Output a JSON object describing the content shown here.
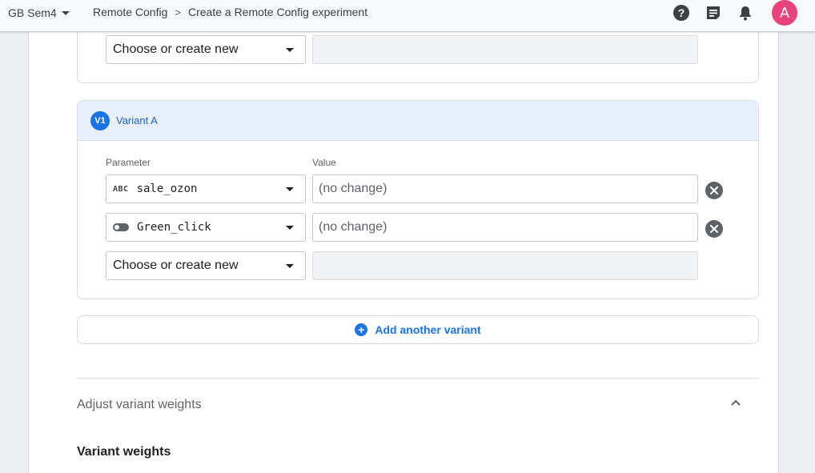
{
  "topbar": {
    "project": "GB Sem4",
    "breadcrumb": {
      "section": "Remote Config",
      "separator": ">",
      "current": "Create a Remote Config experiment"
    },
    "avatar_letter": "A",
    "icons": [
      "help-icon",
      "feedback-icon",
      "notifications-icon"
    ]
  },
  "top_card": {
    "select_placeholder": "Choose or create new"
  },
  "variant": {
    "badge": "V1",
    "title": "Variant A",
    "param_label": "Parameter",
    "value_label": "Value",
    "rows": [
      {
        "type_icon": "text-type-icon",
        "type_label": "ABC",
        "param": "sale_ozon",
        "value": "(no change)"
      },
      {
        "type_icon": "boolean-type-icon",
        "param": "Green_click",
        "value": "(no change)"
      }
    ],
    "new_row_placeholder": "Choose or create new"
  },
  "add_variant": {
    "label": "Add another variant"
  },
  "adjust": {
    "title": "Adjust variant weights"
  },
  "weights": {
    "title": "Variant weights"
  },
  "colors": {
    "accent": "#1a73e8",
    "variant_header_bg": "#e8f0fe",
    "avatar": "#e8437c"
  }
}
